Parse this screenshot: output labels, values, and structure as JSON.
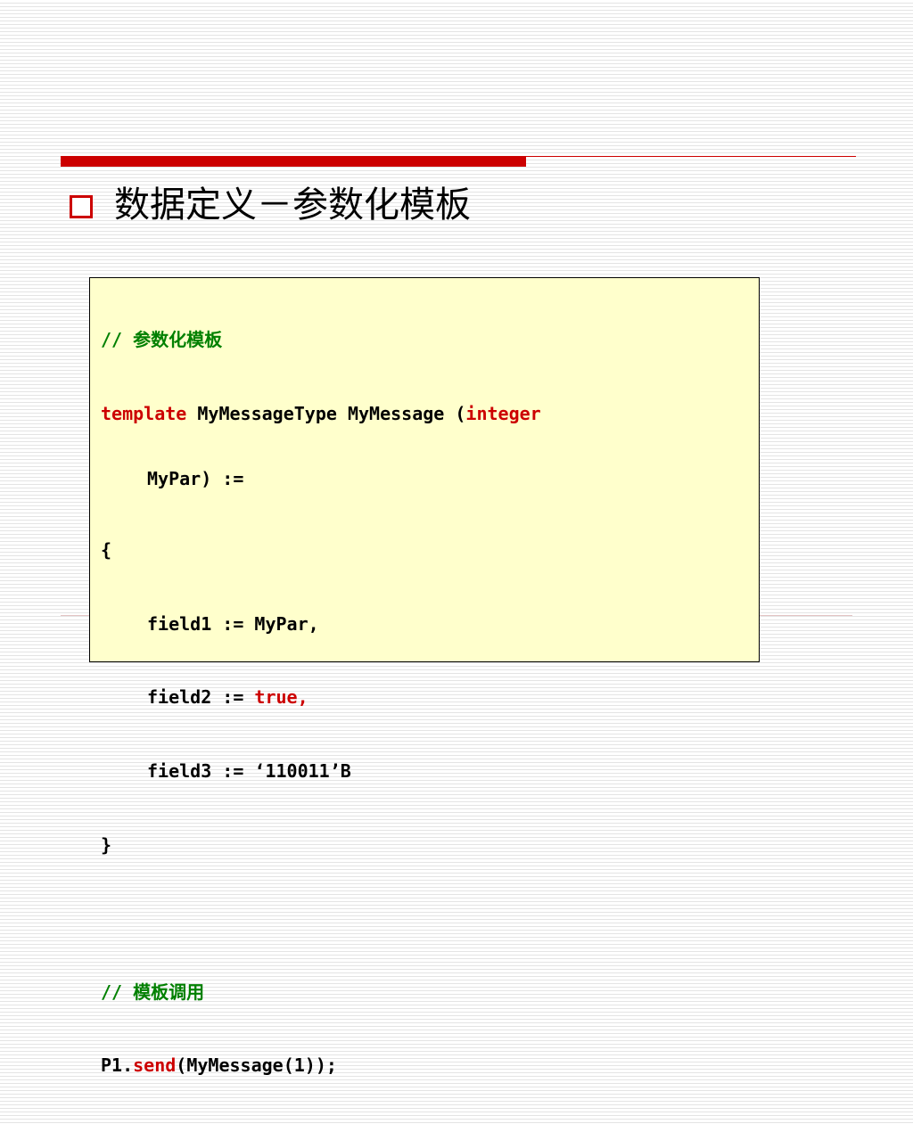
{
  "slide": {
    "title": "数据定义－参数化模板",
    "accent_color": "#cc0000",
    "code_background": "#ffffcc",
    "bullet_icon": "hollow-square-bullet"
  },
  "code": {
    "comment_1": "// 参数化模板",
    "line_template": {
      "keyword": "template",
      "text_1": " MyMessageType MyMessage (",
      "type_keyword": "integer",
      "continuation": "MyPar) :="
    },
    "open_brace": "{",
    "field1": "field1 := MyPar,",
    "field2": {
      "prefix": "field2 := ",
      "value": "true,"
    },
    "field3": "field3 := ‘110011’B",
    "close_brace": "}",
    "comment_2": "// 模板调用",
    "call": {
      "prefix": "P1.",
      "method": "send",
      "suffix": "(MyMessage(1));"
    }
  }
}
